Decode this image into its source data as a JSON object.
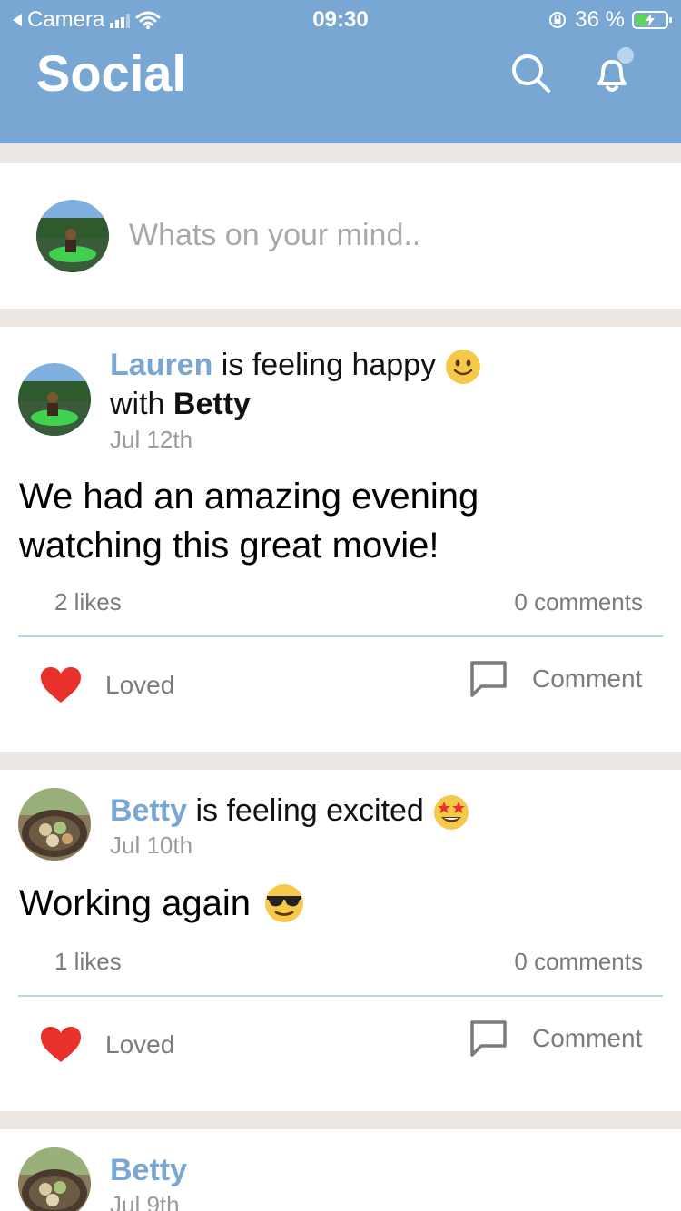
{
  "status_bar": {
    "back_app": "Camera",
    "time": "09:30",
    "battery": "36 %"
  },
  "header": {
    "title": "Social"
  },
  "composer": {
    "placeholder": "Whats on your mind.."
  },
  "posts": [
    {
      "author": "Lauren",
      "feeling": " is feeling happy",
      "with_prefix": "with ",
      "with_name": "Betty",
      "date": "Jul 12th",
      "body": "We had an amazing evening watching this great movie!",
      "likes": "2 likes",
      "comments": "0 comments",
      "love_label": "Loved",
      "comment_label": "Comment"
    },
    {
      "author": "Betty",
      "feeling": " is feeling excited",
      "date": "Jul 10th",
      "body": "Working again",
      "likes": "1 likes",
      "comments": "0 comments",
      "love_label": "Loved",
      "comment_label": "Comment"
    },
    {
      "author": "Betty",
      "date": "Jul 9th"
    }
  ],
  "colors": {
    "header": "#79a7d3",
    "name": "#79a7d3",
    "heart": "#e8312b",
    "divider": "#b9d6e3"
  },
  "icons": [
    "search-icon",
    "bell-icon",
    "heart-icon",
    "comment-icon"
  ]
}
